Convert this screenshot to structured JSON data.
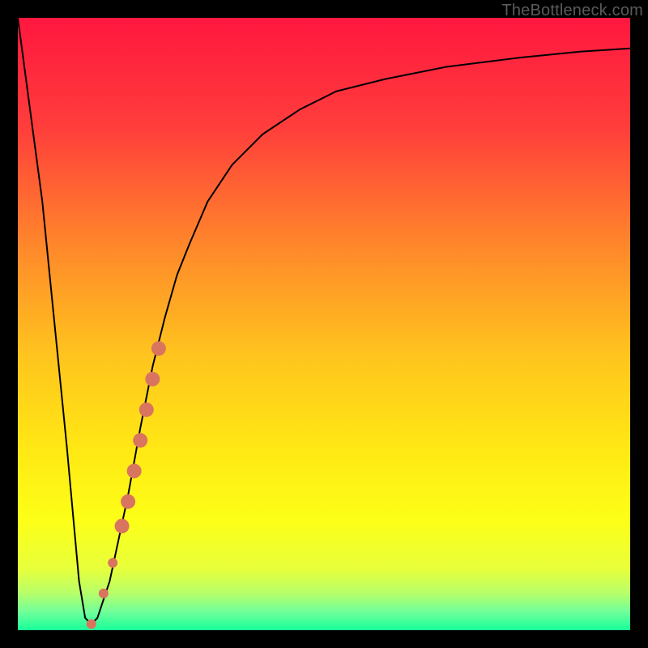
{
  "watermark": "TheBottleneck.com",
  "chart_data": {
    "type": "line",
    "title": "",
    "xlabel": "",
    "ylabel": "",
    "xlim": [
      0,
      100
    ],
    "ylim": [
      0,
      100
    ],
    "grid": false,
    "legend": false,
    "background": {
      "type": "vertical-gradient",
      "stops": [
        {
          "pos": 0.0,
          "color": "#ff173f"
        },
        {
          "pos": 0.18,
          "color": "#ff3e3b"
        },
        {
          "pos": 0.38,
          "color": "#ff8a2a"
        },
        {
          "pos": 0.55,
          "color": "#ffc41e"
        },
        {
          "pos": 0.7,
          "color": "#ffe714"
        },
        {
          "pos": 0.82,
          "color": "#fdff17"
        },
        {
          "pos": 0.9,
          "color": "#e7ff3b"
        },
        {
          "pos": 0.94,
          "color": "#b6ff6a"
        },
        {
          "pos": 0.97,
          "color": "#70ff9a"
        },
        {
          "pos": 1.0,
          "color": "#17ff9a"
        }
      ]
    },
    "series": [
      {
        "name": "bottleneck-curve",
        "color": "#000000",
        "stroke_width": 2,
        "x": [
          0,
          4,
          8,
          10,
          11,
          12,
          13,
          15,
          18,
          20,
          22,
          24,
          26,
          28,
          31,
          35,
          40,
          46,
          52,
          60,
          70,
          82,
          92,
          100
        ],
        "y": [
          100,
          70,
          30,
          8,
          2,
          1,
          2,
          8,
          22,
          33,
          43,
          51,
          58,
          63,
          70,
          76,
          81,
          85,
          88,
          90,
          92,
          93.5,
          94.5,
          95
        ]
      }
    ],
    "markers": {
      "name": "highlight-dots",
      "color": "#d9745f",
      "points": [
        {
          "x": 12.0,
          "y": 1.0,
          "r": 6
        },
        {
          "x": 14.0,
          "y": 6.0,
          "r": 6
        },
        {
          "x": 15.5,
          "y": 11.0,
          "r": 6
        },
        {
          "x": 17.0,
          "y": 17.0,
          "r": 9
        },
        {
          "x": 18.0,
          "y": 21.0,
          "r": 9
        },
        {
          "x": 19.0,
          "y": 26.0,
          "r": 9
        },
        {
          "x": 20.0,
          "y": 31.0,
          "r": 9
        },
        {
          "x": 21.0,
          "y": 36.0,
          "r": 9
        },
        {
          "x": 22.0,
          "y": 41.0,
          "r": 9
        },
        {
          "x": 23.0,
          "y": 46.0,
          "r": 9
        }
      ]
    }
  }
}
